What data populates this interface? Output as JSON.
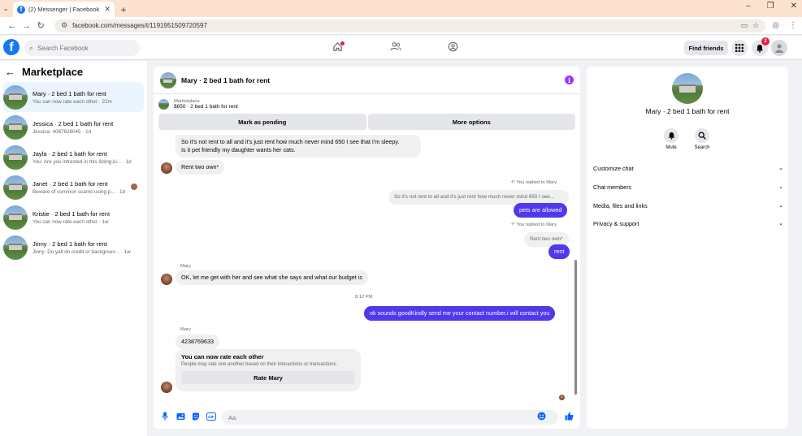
{
  "browser": {
    "tab_title": "(2) Messenger | Facebook",
    "tab_close": "✕",
    "new_tab": "+",
    "url": "facebook.com/messages/t/1191951509720597",
    "win_min": "–",
    "win_max": "❐",
    "win_close": "✕"
  },
  "fb": {
    "logo": "f",
    "search_placeholder": "Search Facebook",
    "find_friends": "Find friends",
    "notif_count": "2"
  },
  "sidebar": {
    "title": "Marketplace",
    "items": [
      {
        "name": "Mary · 2 bed 1 bath for rent",
        "sub": "You can now rate each other · 22m"
      },
      {
        "name": "Jessica · 2 bed 1 bath for rent",
        "sub": "Jessica: 4087628045 · 1d"
      },
      {
        "name": "Jayla · 2 bed 1 bath for rent",
        "sub": "You: Are you intrested in this listing,ki... · 1d"
      },
      {
        "name": "Janet · 2 bed 1 bath for rent",
        "sub": "Beware of common scams using p... · 1d"
      },
      {
        "name": "Kristie · 2 bed 1 bath for rent",
        "sub": "You can now rate each other · 1w"
      },
      {
        "name": "Jinny · 2 bed 1 bath for rent",
        "sub": "Jinny: Do yall do credit or backgroun... · 1w"
      }
    ]
  },
  "chat": {
    "title": "Mary · 2 bed 1 bath for rent",
    "listing_label": "Marketplace",
    "listing_desc": "$650 · 2 bed 1 bath for rent",
    "mark_pending": "Mark as pending",
    "more_options": "More options",
    "messages": {
      "m1": "So it's not rent to all and it's just rent how much never mind 650 I see that I'm sleepy.",
      "m1b": "Is it pet friendly my daughter wants her cats.",
      "m2": "Rent two own*",
      "reply1_label": "You replied to Mary",
      "reply1_quote": "So it's not rent to all and it's just rent how much never mind 650 I see...",
      "m3": "pets are allowed",
      "reply2_label": "You replied to Mary",
      "reply2_quote": "Rent two own*",
      "m4": "rent",
      "sender1": "Mary",
      "m5": "OK, let me get with her and see what she says and what our budget is",
      "time": "8:12 PM",
      "m6": "ok sounds goodKindly send me your contact number.i will contact you",
      "sender2": "Mary",
      "m7": "4238769633",
      "rate_title": "You can now rate each other",
      "rate_desc": "People may rate one another based on their interactions or transactions.",
      "rate_btn": "Rate Mary"
    },
    "composer_placeholder": "Aa"
  },
  "right": {
    "title": "Mary · 2 bed 1 bath for rent",
    "mute": "Mute",
    "search": "Search",
    "sections": [
      "Customize chat",
      "Chat members",
      "Media, files and links",
      "Privacy & support"
    ]
  },
  "colors": {
    "brand": "#1877f2",
    "outgoing": "#5038ed",
    "accent_info": "#a033ff"
  }
}
